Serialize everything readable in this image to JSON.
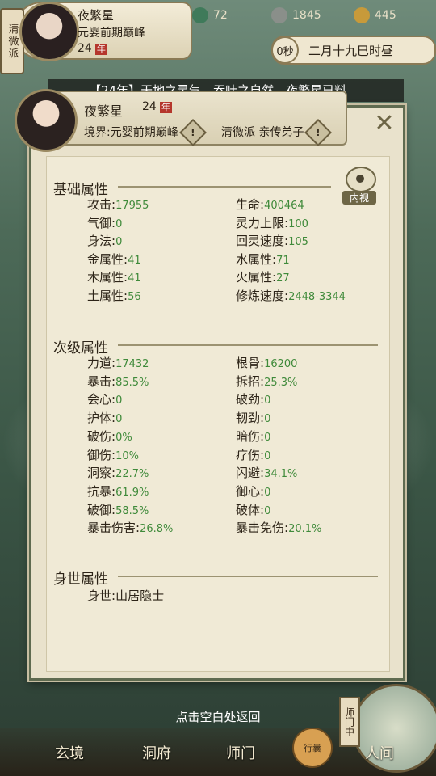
{
  "topbar": {
    "sect_badge": "清微派",
    "name": "夜繁星",
    "realm": "元婴前期巅峰",
    "age": "24",
    "age_unit": "年",
    "resources": [
      {
        "icon": "jade-icon",
        "value": "72"
      },
      {
        "icon": "coin-icon",
        "value": "1845"
      },
      {
        "icon": "gold-ingot-icon",
        "value": "445"
      }
    ],
    "time_seconds": "0秒",
    "date": "二月十九巳时昼"
  },
  "ticker": "【24年】天地之灵气，吞吐之自然，夜繁星已料",
  "character": {
    "name": "夜繁星",
    "age": "24",
    "age_unit": "年",
    "realm": "境界:元婴前期巅峰",
    "sect": "清微派 亲传弟子"
  },
  "inner_view_label": "内视",
  "basic": {
    "title": "基础属性",
    "left": [
      {
        "label": "攻击",
        "value": "17955"
      },
      {
        "label": "气御",
        "value": "0"
      },
      {
        "label": "身法",
        "value": "0"
      },
      {
        "label": "金属性",
        "value": "41"
      },
      {
        "label": "木属性",
        "value": "41"
      },
      {
        "label": "土属性",
        "value": "56"
      }
    ],
    "right": [
      {
        "label": "生命",
        "value": "400464"
      },
      {
        "label": "灵力上限",
        "value": "100"
      },
      {
        "label": "回灵速度",
        "value": "105"
      },
      {
        "label": "水属性",
        "value": "71"
      },
      {
        "label": "火属性",
        "value": "27"
      },
      {
        "label": "修炼速度",
        "value": "2448-3344"
      }
    ]
  },
  "secondary": {
    "title": "次级属性",
    "left": [
      {
        "label": "力道",
        "value": "17432"
      },
      {
        "label": "暴击",
        "value": "85.5%"
      },
      {
        "label": "会心",
        "value": "0"
      },
      {
        "label": "护体",
        "value": "0"
      },
      {
        "label": "破伤",
        "value": "0%"
      },
      {
        "label": "御伤",
        "value": "10%"
      },
      {
        "label": "洞察",
        "value": "22.7%"
      },
      {
        "label": "抗暴",
        "value": "61.9%"
      },
      {
        "label": "破御",
        "value": "58.5%"
      },
      {
        "label": "暴击伤害",
        "value": "26.8%"
      }
    ],
    "right": [
      {
        "label": "根骨",
        "value": "16200"
      },
      {
        "label": "拆招",
        "value": "25.3%"
      },
      {
        "label": "破劲",
        "value": "0"
      },
      {
        "label": "韧劲",
        "value": "0"
      },
      {
        "label": "暗伤",
        "value": "0"
      },
      {
        "label": "疗伤",
        "value": "0"
      },
      {
        "label": "闪避",
        "value": "34.1%"
      },
      {
        "label": "御心",
        "value": "0"
      },
      {
        "label": "破体",
        "value": "0"
      },
      {
        "label": "暴击免伤",
        "value": "20.1%"
      }
    ]
  },
  "origin": {
    "title": "身世属性",
    "label": "身世",
    "value": "山居隐士"
  },
  "return_hint": "点击空白处返回",
  "nav": {
    "items": [
      "玄境",
      "洞府",
      "师门",
      "人间"
    ],
    "side_button": "师门中",
    "mid_button": "行囊"
  },
  "colors": {
    "value_green": "#3f8a3a",
    "panel_bg": "#e9e2cc",
    "text": "#2d2418"
  }
}
